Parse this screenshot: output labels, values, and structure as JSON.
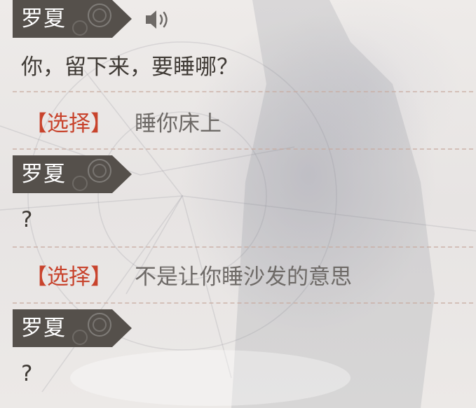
{
  "colors": {
    "name_tag_bg": "#55504b",
    "choice_tag": "#c8432c",
    "dialogue_text": "#3f3a35",
    "choice_text": "#6e6a67",
    "divider": "#d4b3aa"
  },
  "log": [
    {
      "speaker": "罗夏",
      "line": "你，留下来，要睡哪？",
      "has_voice": true,
      "voice_icon": "speaker-icon"
    },
    {
      "choice_tag": "【选择】",
      "choice_text": "睡你床上"
    },
    {
      "speaker": "罗夏",
      "line": "?"
    },
    {
      "choice_tag": "【选择】",
      "choice_text": "不是让你睡沙发的意思"
    },
    {
      "speaker": "罗夏",
      "line": "?"
    }
  ]
}
